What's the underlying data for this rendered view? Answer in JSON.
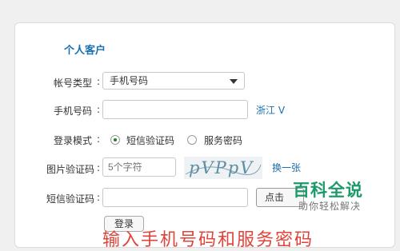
{
  "header": {
    "title": "个人客户"
  },
  "form": {
    "account_type": {
      "label": "帐号类型",
      "value": "手机号码"
    },
    "phone": {
      "label": "手机号码",
      "value": "",
      "region_link": "浙江 V"
    },
    "login_mode": {
      "label": "登录模式",
      "options": [
        {
          "label": "短信验证码",
          "checked": true
        },
        {
          "label": "服务密码",
          "checked": false
        }
      ]
    },
    "image_code": {
      "label": "图片验证码",
      "placeholder": "5个字符",
      "captcha_text": "pVPpV",
      "refresh_link": "换一张"
    },
    "sms_code": {
      "label": "短信验证码",
      "value": "",
      "send_button": "点击"
    },
    "colon": ":",
    "login_button": "登录"
  },
  "watermark": {
    "title": "百科全说",
    "subtitle": "助你轻松解决"
  },
  "caption": "输入手机号码和服务密码",
  "colors": {
    "accent": "#1a6faf",
    "watermark": "#1d9a6a",
    "caption": "#e0433a"
  }
}
